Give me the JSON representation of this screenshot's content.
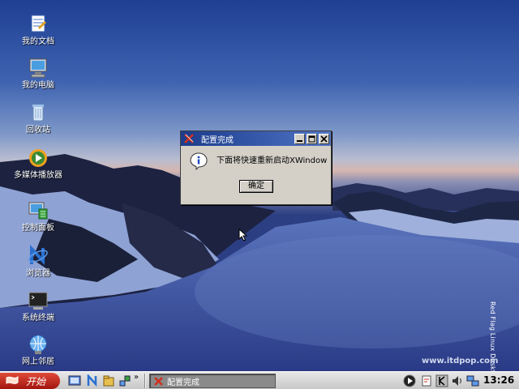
{
  "desktop": {
    "icons": [
      {
        "label": "我的文档",
        "icon": "documents-icon"
      },
      {
        "label": "我的电脑",
        "icon": "computer-icon"
      },
      {
        "label": "回收站",
        "icon": "trash-icon"
      },
      {
        "label": "多媒体播放器",
        "icon": "media-player-icon"
      },
      {
        "label": "控制面板",
        "icon": "control-panel-icon"
      },
      {
        "label": "浏览器",
        "icon": "browser-icon"
      },
      {
        "label": "系统终端",
        "icon": "terminal-icon"
      },
      {
        "label": "网上邻居",
        "icon": "network-icon"
      }
    ],
    "watermark": "Red Flag Linux Desktop",
    "site_watermark": "www.itdpop.com"
  },
  "dialog": {
    "title": "配置完成",
    "message": "下面将快速重新启动XWindow",
    "ok_label": "确定"
  },
  "taskbar": {
    "start_label": "开始",
    "overflow_label": "»",
    "task_label": "配置完成",
    "clock": "13:26"
  },
  "colors": {
    "title_bar": "#1c3c8c",
    "start_button": "#c0281c",
    "dialog_bg": "#d4d0c8"
  }
}
